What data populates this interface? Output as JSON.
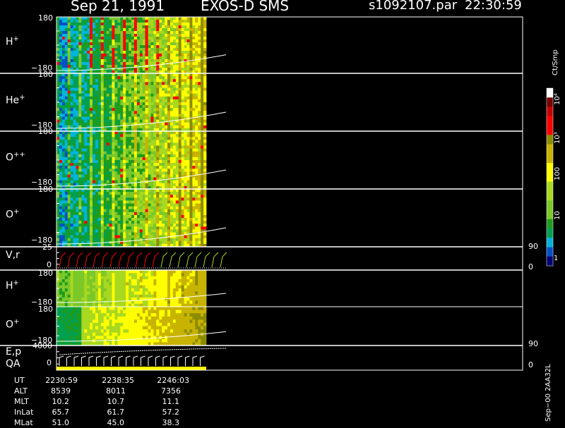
{
  "header": {
    "date": "Sep 21, 1991",
    "instrument": "EXOS-D SMS",
    "file": "s1092107.par",
    "time": "22:30:59"
  },
  "panels": [
    {
      "label": "H",
      "sup": "+",
      "ymax": "180",
      "ymin": "−180"
    },
    {
      "label": "He",
      "sup": "+",
      "ymax": "180",
      "ymin": "−180"
    },
    {
      "label": "O",
      "sup": "++",
      "ymax": "180",
      "ymin": "−180"
    },
    {
      "label": "O",
      "sup": "+",
      "ymax": "180",
      "ymin": "−180"
    },
    {
      "label": "V,r",
      "ymax": "25",
      "ymin": "0",
      "rmax": "90",
      "rmin": "0"
    },
    {
      "label": "H",
      "sup": "+",
      "ymax": "180",
      "ymin": "−180"
    },
    {
      "label": "O",
      "sup": "+",
      "ymax": "180",
      "ymin": "−180"
    },
    {
      "label": "E,p",
      "label2": "QA",
      "ymax": "4000",
      "ymin": "0",
      "rmax": "90",
      "rmin": "0"
    }
  ],
  "colorbar": {
    "title": "Ct/Smp",
    "ticks": [
      "1",
      "10",
      "100",
      "10³",
      "10⁴"
    ],
    "colors": [
      "#000078",
      "#0050c8",
      "#00b4dc",
      "#00a050",
      "#1e9c1e",
      "#7cc828",
      "#a8d820",
      "#ffff00",
      "#c8b400",
      "#8c8c00",
      "#ff0000",
      "#c80000",
      "#780000",
      "#ffffff"
    ]
  },
  "footer": {
    "rev_label": "Sep−00  2AA32L"
  },
  "ephemeris": {
    "labels": [
      "UT",
      "ALT",
      "MLT",
      "InLat",
      "MLat"
    ],
    "columns": [
      [
        "2230:59",
        "8539",
        "10.2",
        "65.7",
        "51.0"
      ],
      [
        "2238:35",
        "8011",
        "10.7",
        "61.7",
        "45.0"
      ],
      [
        "2246:03",
        "7356",
        "11.1",
        "57.2",
        "38.3"
      ]
    ]
  },
  "chart_data": {
    "type": "heatmap",
    "title": "EXOS-D SMS",
    "x": [
      "2230:59",
      "2238:35",
      "2246:03"
    ],
    "panels": [
      "H+",
      "He+",
      "O++",
      "O+",
      "V,r",
      "H+",
      "O+",
      "E,p QA"
    ],
    "pitch_angle_range": [
      -180,
      180
    ],
    "colorbar_range": [
      1,
      10000
    ],
    "colorbar_scale": "log",
    "grid": false
  }
}
